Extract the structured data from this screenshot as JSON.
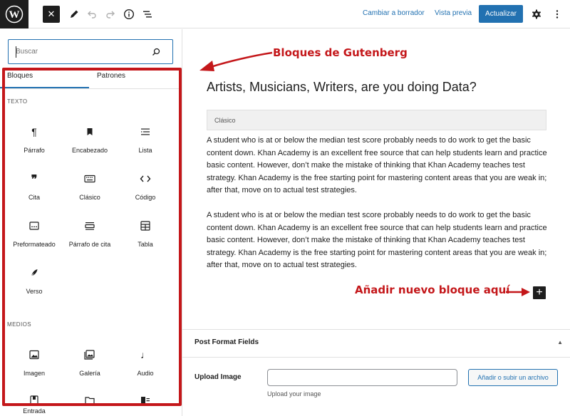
{
  "topbar": {
    "close_label": "✕",
    "switch_draft": "Cambiar a borrador",
    "preview": "Vista previa",
    "update": "Actualizar"
  },
  "sidebar": {
    "search_placeholder": "Buscar",
    "tabs": [
      "Bloques",
      "Patrones"
    ],
    "sections": [
      {
        "label": "TEXTO",
        "blocks": [
          {
            "label": "Párrafo",
            "icon": "paragraph-icon"
          },
          {
            "label": "Encabezado",
            "icon": "bookmark-icon"
          },
          {
            "label": "Lista",
            "icon": "list-icon"
          },
          {
            "label": "Cita",
            "icon": "quote-icon"
          },
          {
            "label": "Clásico",
            "icon": "keyboard-icon"
          },
          {
            "label": "Código",
            "icon": "code-icon"
          },
          {
            "label": "Preformateado",
            "icon": "preformatted-icon"
          },
          {
            "label": "Párrafo de cita",
            "icon": "pullquote-icon"
          },
          {
            "label": "Tabla",
            "icon": "table-icon"
          },
          {
            "label": "Verso",
            "icon": "feather-icon"
          }
        ]
      },
      {
        "label": "MEDIOS",
        "blocks": [
          {
            "label": "Imagen",
            "icon": "image-icon"
          },
          {
            "label": "Galería",
            "icon": "gallery-icon"
          },
          {
            "label": "Audio",
            "icon": "audio-icon"
          },
          {
            "label": "Entrada",
            "icon": "entry-icon"
          }
        ]
      }
    ]
  },
  "annotations": {
    "gutenberg": "Bloques de Gutenberg",
    "add_block": "Añadir nuevo bloque aquí"
  },
  "editor": {
    "title": "Artists, Musicians, Writers, are you doing Data?",
    "classic_label": "Clásico",
    "paragraphs": [
      "A student who is at or below the median test score probably needs to do work to get the basic content down. Khan Academy is an excellent free source that can help students learn and practice basic content. However, don’t make the mistake of thinking that Khan Academy teaches test strategy. Khan Academy is the free starting point for mastering content areas that you are weak in; after that, move on to actual test strategies.",
      "A student who is at or below the median test score probably needs to do work to get the basic content down. Khan Academy is an excellent free source that can help students learn and practice basic content. However, don’t make the mistake of thinking that Khan Academy teaches test strategy. Khan Academy is the free starting point for mastering content areas that you are weak in; after that, move on to actual test strategies."
    ],
    "add_block_symbol": "+"
  },
  "meta_box": {
    "title": "Post Format Fields",
    "upload_label": "Upload Image",
    "upload_button": "Añadir o subir un archivo",
    "upload_help": "Upload your image"
  },
  "colors": {
    "accent": "#2271b1",
    "annotation_red": "#c4171a",
    "dark": "#1e1e1e"
  }
}
